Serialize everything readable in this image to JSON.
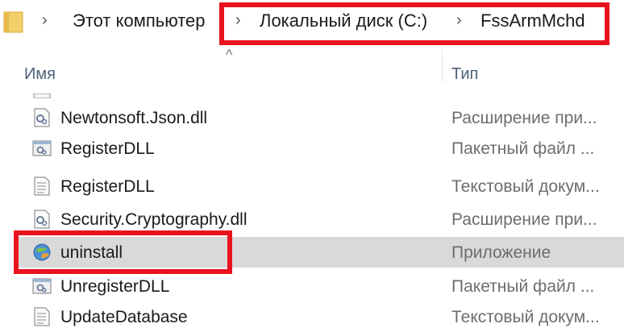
{
  "breadcrumb": {
    "items": [
      "Этот компьютер",
      "Локальный диск (C:)",
      "FssArmMchd"
    ],
    "separator": "›"
  },
  "columns": {
    "name": "Имя",
    "type": "Тип"
  },
  "files": [
    {
      "name": "Newtonsoft.Json.dll",
      "type": "Расширение при...",
      "icon": "dll-file-icon"
    },
    {
      "name": "RegisterDLL",
      "type": "Пакетный файл ...",
      "icon": "batch-file-icon"
    },
    {
      "name": "RegisterDLL",
      "type": "Текстовый докум...",
      "icon": "text-file-icon"
    },
    {
      "name": "Security.Cryptography.dll",
      "type": "Расширение при...",
      "icon": "dll-file-icon"
    },
    {
      "name": "uninstall",
      "type": "Приложение",
      "icon": "application-icon"
    },
    {
      "name": "UnregisterDLL",
      "type": "Пакетный файл ...",
      "icon": "batch-file-icon"
    },
    {
      "name": "UpdateDatabase",
      "type": "Текстовый докум...",
      "icon": "text-file-icon"
    }
  ],
  "selected_index": 4,
  "highlight_color": "#e8131e"
}
